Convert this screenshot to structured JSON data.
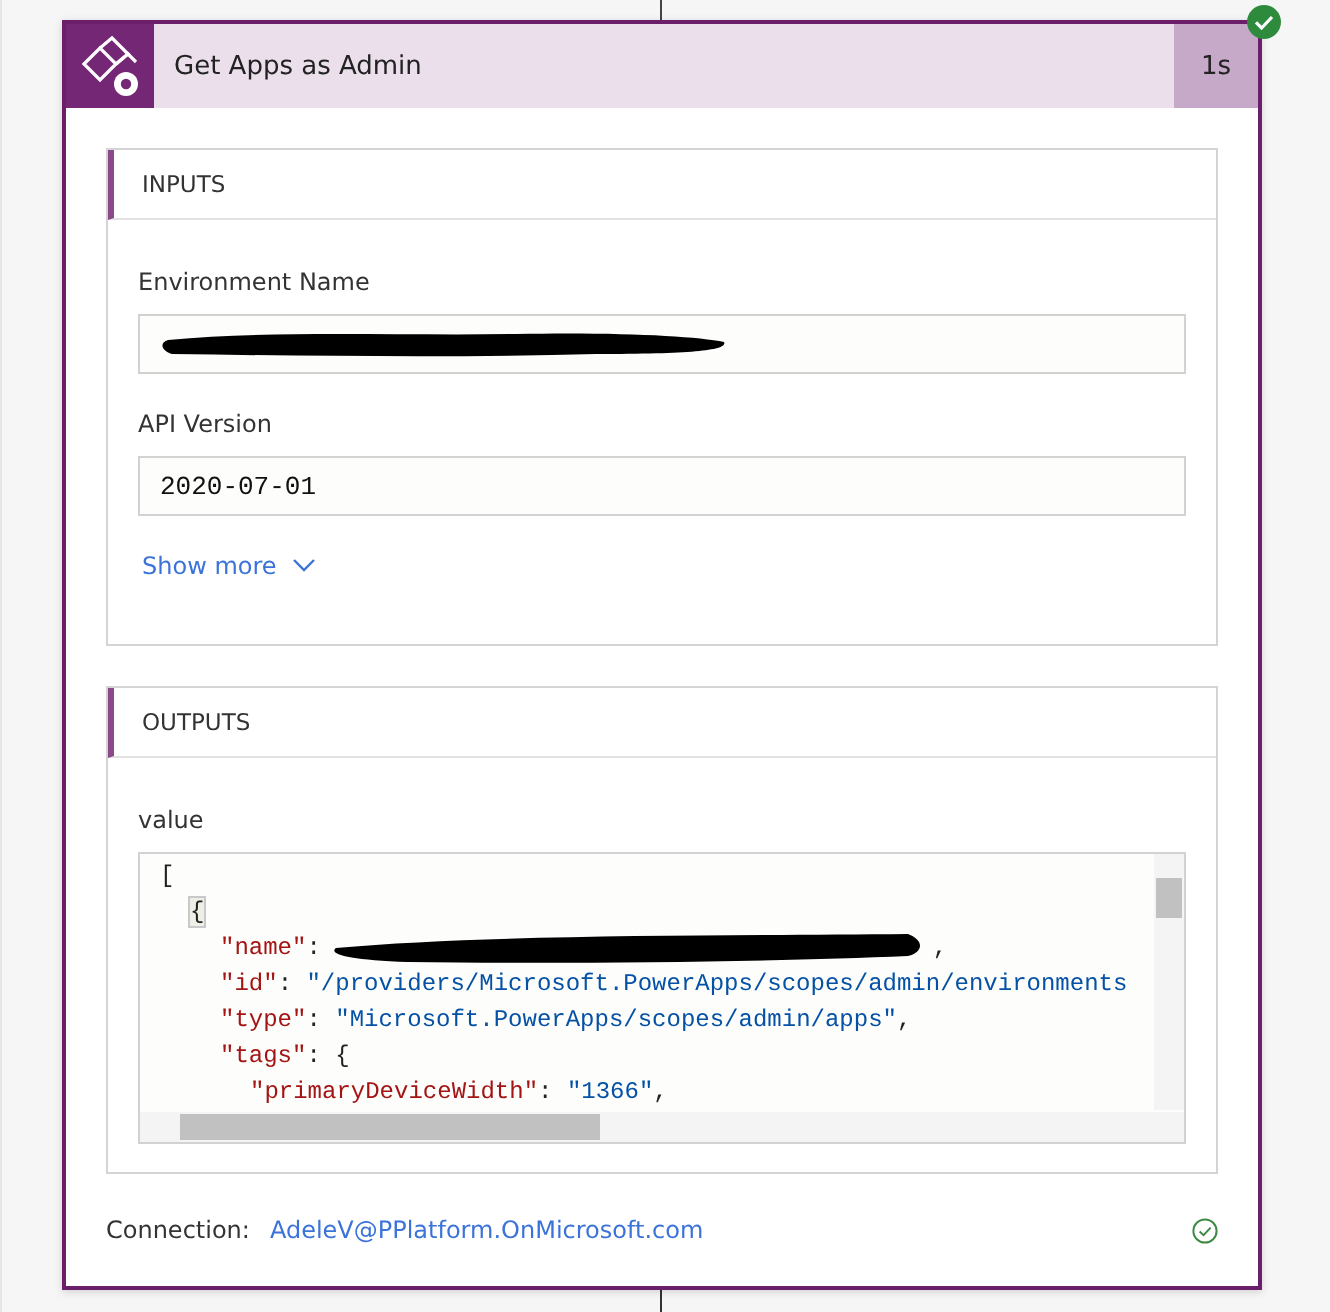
{
  "action": {
    "title": "Get Apps as Admin",
    "duration": "1s",
    "succeeded": true
  },
  "inputs": {
    "heading": "INPUTS",
    "fields": [
      {
        "label": "Environment Name",
        "redacted": true
      },
      {
        "label": "API Version",
        "value": "2020-07-01",
        "redacted": false
      }
    ],
    "show_more": "Show more"
  },
  "outputs": {
    "heading": "OUTPUTS",
    "label": "value",
    "code_lines": [
      {
        "tokens": [
          {
            "kind": "punct",
            "text": "["
          }
        ],
        "children": [
          {
            "tokens": [
              {
                "kind": "brace",
                "text": "{"
              }
            ],
            "children": [
              {
                "tokens": [
                  {
                    "kind": "key",
                    "text": "\"name\""
                  },
                  {
                    "kind": "punct",
                    "text": ":"
                  },
                  {
                    "kind": "redaction"
                  },
                  {
                    "kind": "punct",
                    "text": ","
                  }
                ]
              },
              {
                "tokens": [
                  {
                    "kind": "key",
                    "text": "\"id\""
                  },
                  {
                    "kind": "punct",
                    "text": ": "
                  },
                  {
                    "kind": "value",
                    "text": "\"/providers/Microsoft.PowerApps/scopes/admin/environments"
                  }
                ]
              },
              {
                "tokens": [
                  {
                    "kind": "key",
                    "text": "\"type\""
                  },
                  {
                    "kind": "punct",
                    "text": ": "
                  },
                  {
                    "kind": "value",
                    "text": "\"Microsoft.PowerApps/scopes/admin/apps\""
                  },
                  {
                    "kind": "punct",
                    "text": ","
                  }
                ]
              },
              {
                "tokens": [
                  {
                    "kind": "key",
                    "text": "\"tags\""
                  },
                  {
                    "kind": "punct",
                    "text": ": {"
                  }
                ],
                "children": [
                  {
                    "tokens": [
                      {
                        "kind": "key",
                        "text": "\"primaryDeviceWidth\""
                      },
                      {
                        "kind": "punct",
                        "text": ": "
                      },
                      {
                        "kind": "value",
                        "text": "\"1366\""
                      },
                      {
                        "kind": "punct",
                        "text": ","
                      }
                    ]
                  }
                ]
              }
            ]
          }
        ]
      }
    ]
  },
  "connection": {
    "label": "Connection:",
    "value": "AdeleV@PPlatform.OnMicrosoft.com",
    "ok": true
  }
}
